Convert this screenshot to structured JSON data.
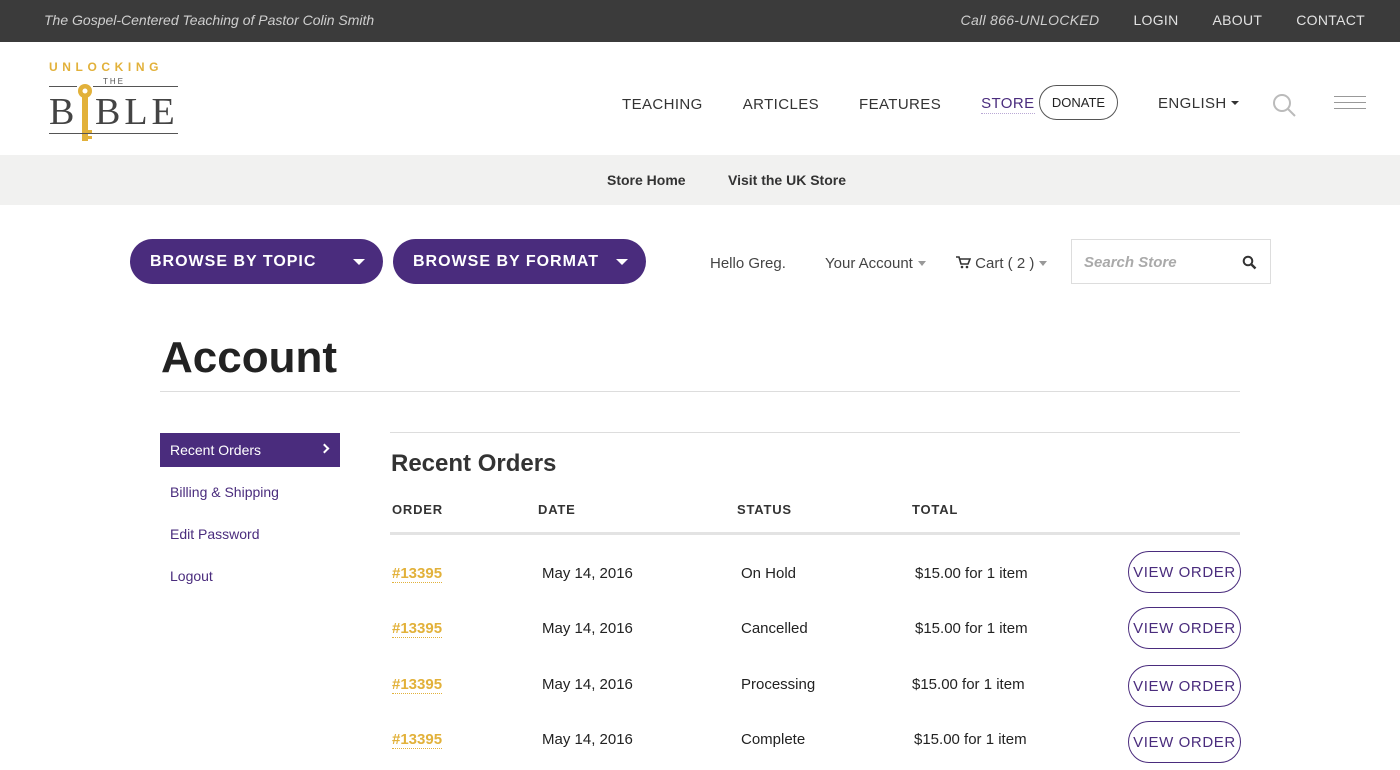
{
  "topbar": {
    "tagline": "The Gospel-Centered Teaching of Pastor Colin Smith",
    "phone": "Call 866-UNLOCKED",
    "login": "LOGIN",
    "about": "ABOUT",
    "contact": "CONTACT"
  },
  "logo": {
    "line1": "UNLOCKING",
    "line2": "THE",
    "line3": "BIBLE"
  },
  "nav": {
    "teaching": "TEACHING",
    "articles": "ARTICLES",
    "features": "FEATURES",
    "store": "STORE",
    "donate": "DONATE",
    "language": "ENGLISH"
  },
  "subnav": {
    "store_home": "Store Home",
    "uk_store": "Visit the UK Store"
  },
  "store": {
    "browse_topic": "BROWSE BY TOPIC",
    "browse_format": "BROWSE BY FORMAT",
    "hello": "Hello Greg.",
    "account": "Your Account",
    "cart": "Cart ( 2 )",
    "search_placeholder": "Search Store"
  },
  "page": {
    "title": "Account"
  },
  "sidebar": {
    "items": [
      {
        "label": "Recent Orders",
        "active": true
      },
      {
        "label": "Billing & Shipping"
      },
      {
        "label": "Edit Password"
      },
      {
        "label": "Logout"
      }
    ]
  },
  "orders": {
    "title": "Recent Orders",
    "headers": [
      "ORDER",
      "DATE",
      "STATUS",
      "TOTAL"
    ],
    "button_label": "VIEW ORDER",
    "rows": [
      {
        "order": "#13395",
        "date": "May 14, 2016",
        "status": "On Hold",
        "total": "$15.00 for 1 item"
      },
      {
        "order": "#13395",
        "date": "May 14, 2016",
        "status": "Cancelled",
        "total": "$15.00 for 1 item"
      },
      {
        "order": "#13395",
        "date": "May 14, 2016",
        "status": "Processing",
        "total": "$15.00 for 1 item"
      },
      {
        "order": "#13395",
        "date": "May 14, 2016",
        "status": "Complete",
        "total": "$15.00 for 1 item"
      }
    ]
  },
  "colors": {
    "brand_purple": "#4a2c7d",
    "brand_gold": "#e2b13a",
    "topbar": "#3b3b3b"
  }
}
